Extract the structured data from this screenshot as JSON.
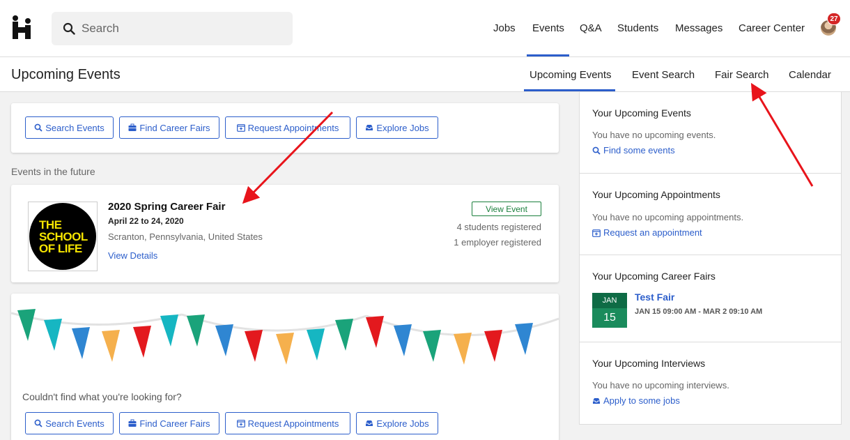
{
  "topbar": {
    "search_placeholder": "Search",
    "nav": [
      "Jobs",
      "Events",
      "Q&A",
      "Students",
      "Messages",
      "Career Center"
    ],
    "notification_count": "27"
  },
  "subbar": {
    "title": "Upcoming Events",
    "tabs": [
      "Upcoming Events",
      "Event Search",
      "Fair Search",
      "Calendar"
    ]
  },
  "actions": {
    "search_events": "Search Events",
    "find_career_fairs": "Find Career Fairs",
    "request_appointments": "Request Appointments",
    "explore_jobs": "Explore Jobs"
  },
  "events_label": "Events in the future",
  "event": {
    "logo_lines": [
      "THE",
      "SCHOOL",
      "OF LIFE"
    ],
    "title": "2020 Spring Career Fair",
    "date": "April 22 to 24, 2020",
    "location": "Scranton, Pennsylvania, United States",
    "details_link": "View Details",
    "view_button": "View Event",
    "students": "4 students registered",
    "employers": "1 employer registered"
  },
  "footer_card": {
    "prompt": "Couldn't find what you're looking for?"
  },
  "sidebar": {
    "events": {
      "title": "Your Upcoming Events",
      "empty": "You have no upcoming events.",
      "link": "Find some events"
    },
    "appointments": {
      "title": "Your Upcoming Appointments",
      "empty": "You have no upcoming appointments.",
      "link": "Request an appointment"
    },
    "fairs": {
      "title": "Your Upcoming Career Fairs",
      "month": "JAN",
      "day": "15",
      "name": "Test Fair",
      "range": "JAN 15 09:00 AM - MAR 2 09:10 AM"
    },
    "interviews": {
      "title": "Your Upcoming Interviews",
      "empty": "You have no upcoming interviews.",
      "link": "Apply to some jobs"
    }
  },
  "colors": {
    "accent": "#2c5ecb",
    "green": "#1a7f3c",
    "arrow": "#e8141b",
    "flags": [
      "#1aa37a",
      "#16b6c2",
      "#2f86d2",
      "#f5b04d",
      "#e3191e"
    ]
  }
}
